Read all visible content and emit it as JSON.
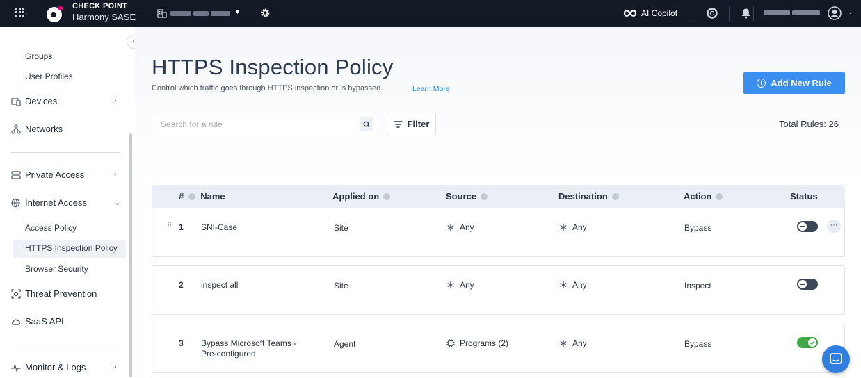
{
  "topbar": {
    "brand_line1": "CHECK POINT",
    "brand_line2": "Harmony SASE",
    "copilot_label": "AI Copilot"
  },
  "sidebar": {
    "sub_items_top": [
      "Groups",
      "User Profiles"
    ],
    "items": {
      "devices": "Devices",
      "networks": "Networks",
      "private_access": "Private Access",
      "internet_access": "Internet Access",
      "threat_prevention": "Threat Prevention",
      "saas_api": "SaaS API",
      "monitor_logs": "Monitor & Logs"
    },
    "internet_access_children": [
      "Access Policy",
      "HTTPS Inspection Policy",
      "Browser Security"
    ],
    "selected": "HTTPS Inspection Policy"
  },
  "page": {
    "title": "HTTPS Inspection Policy",
    "subtitle": "Control which traffic goes through HTTPS inspection or is bypassed.",
    "learn_more": "Learn More",
    "add_button": "Add New Rule",
    "search_placeholder": "Search for a rule",
    "filter_label": "Filter",
    "total_rules": "Total Rules: 26"
  },
  "table": {
    "headers": {
      "num": "#",
      "name": "Name",
      "applied_on": "Applied on",
      "source": "Source",
      "destination": "Destination",
      "action": "Action",
      "status": "Status"
    },
    "rows": [
      {
        "num": "1",
        "name": "SNI-Case",
        "name_line2": "",
        "applied_on": "Site",
        "source": "Any",
        "source_icon": "asterisk-icon",
        "destination": "Any",
        "action": "Bypass",
        "enabled": false
      },
      {
        "num": "2",
        "name": "inspect all",
        "name_line2": "",
        "applied_on": "Site",
        "source": "Any",
        "source_icon": "asterisk-icon",
        "destination": "Any",
        "action": "Inspect",
        "enabled": false
      },
      {
        "num": "3",
        "name": "Bypass Microsoft Teams -",
        "name_line2": "Pre-configured",
        "applied_on": "Agent",
        "source": "Programs (2)",
        "source_icon": "chip-icon",
        "destination": "Any",
        "action": "Bypass",
        "enabled": true
      }
    ]
  },
  "colors": {
    "topbar_bg": "#131a26",
    "accent": "#3b8ff0",
    "toggle_on": "#3fa845",
    "toggle_off": "#3c4758"
  }
}
